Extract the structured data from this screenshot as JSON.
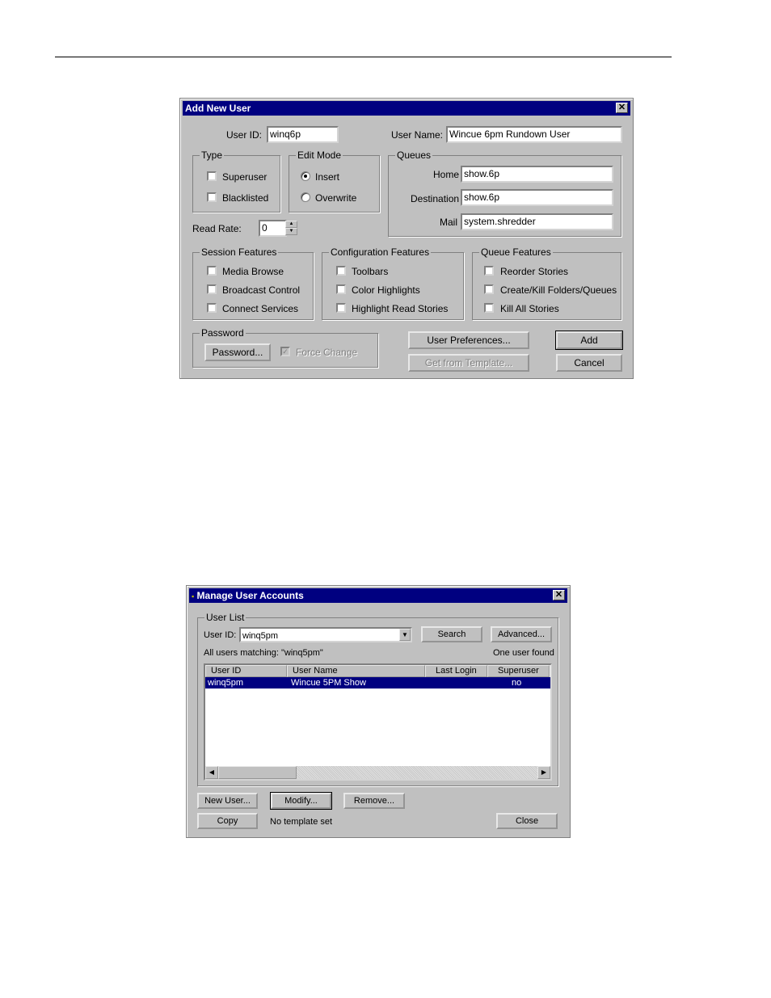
{
  "add_user": {
    "title": "Add New User",
    "user_id_label": "User ID:",
    "user_id_value": "winq6p",
    "user_name_label": "User Name:",
    "user_name_value": "Wincue 6pm Rundown User",
    "type": {
      "legend": "Type",
      "superuser": "Superuser",
      "blacklisted": "Blacklisted"
    },
    "edit_mode": {
      "legend": "Edit Mode",
      "insert": "Insert",
      "overwrite": "Overwrite",
      "selected": "Insert"
    },
    "queues": {
      "legend": "Queues",
      "home_label": "Home",
      "home_value": "show.6p",
      "destination_label": "Destination",
      "destination_value": "show.6p",
      "mail_label": "Mail",
      "mail_value": "system.shredder"
    },
    "read_rate_label": "Read Rate:",
    "read_rate_value": "0",
    "session_features": {
      "legend": "Session Features",
      "items": [
        "Media Browse",
        "Broadcast Control",
        "Connect Services"
      ]
    },
    "config_features": {
      "legend": "Configuration Features",
      "items": [
        "Toolbars",
        "Color Highlights",
        "Highlight Read Stories"
      ]
    },
    "queue_features": {
      "legend": "Queue Features",
      "items": [
        "Reorder Stories",
        "Create/Kill Folders/Queues",
        "Kill All Stories"
      ]
    },
    "password": {
      "legend": "Password",
      "button": "Password...",
      "force_change": "Force Change"
    },
    "buttons": {
      "user_prefs": "User Preferences...",
      "get_template": "Get from Template...",
      "add": "Add",
      "cancel": "Cancel"
    }
  },
  "manage": {
    "title": "Manage User Accounts",
    "user_list_legend": "User List",
    "user_id_label": "User ID:",
    "user_id_value": "winq5pm",
    "search_button": "Search",
    "advanced_button": "Advanced...",
    "matching_text": "All users matching:  \"winq5pm\"",
    "found_text": "One user found",
    "columns": [
      "User ID",
      "User Name",
      "Last Login",
      "Superuser"
    ],
    "rows": [
      {
        "user_id": "winq5pm",
        "user_name": "Wincue 5PM Show",
        "last_login": "",
        "superuser": "no"
      }
    ],
    "buttons": {
      "new_user": "New User...",
      "modify": "Modify...",
      "remove": "Remove...",
      "copy": "Copy",
      "close": "Close"
    },
    "template_status": "No template set"
  }
}
